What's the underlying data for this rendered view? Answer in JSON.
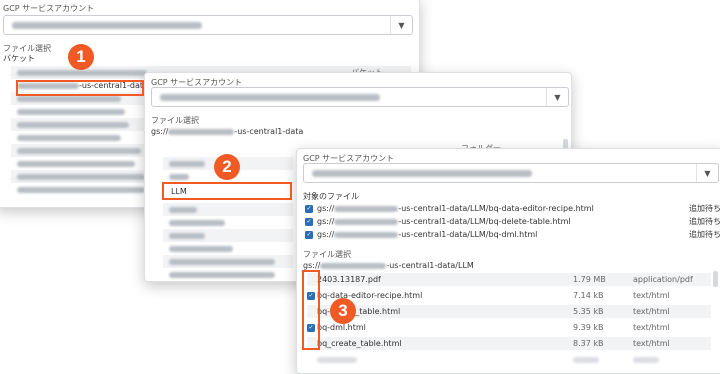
{
  "panel1": {
    "account_label": "GCP サービスアカウント",
    "file_select_label": "ファイル選択",
    "bucket_label": "バケット",
    "bucket_type": "バケット",
    "highlighted_suffix": "-us-central1-data"
  },
  "panel2": {
    "account_label": "GCP サービスアカウント",
    "file_select_label": "ファイル選択",
    "path_prefix": "gs://",
    "path_suffix": "-us-central1-data",
    "folder_type": "フォルダー",
    "folders": [
      "LLM"
    ]
  },
  "panel3": {
    "account_label": "GCP サービスアカウント",
    "target_files_label": "対象のファイル",
    "target_files": [
      {
        "prefix": "gs://",
        "suffix": "-us-central1-data/LLM/bq-data-editor-recipe.html",
        "status": "追加待ち"
      },
      {
        "prefix": "gs://",
        "suffix": "-us-central1-data/LLM/bq-delete-table.html",
        "status": "追加待ち"
      },
      {
        "prefix": "gs://",
        "suffix": "-us-central1-data/LLM/bq-dml.html",
        "status": "追加待ち"
      }
    ],
    "file_select_label": "ファイル選択",
    "path_prefix": "gs://",
    "path_suffix": "-us-central1-data/LLM",
    "files": [
      {
        "name": "2403.13187.pdf",
        "size": "1.79 MB",
        "type": "application/pdf"
      },
      {
        "name": "bq-data-editor-recipe.html",
        "size": "7.14 kB",
        "type": "text/html"
      },
      {
        "name": "bq-delete_table.html",
        "size": "5.35 kB",
        "type": "text/html"
      },
      {
        "name": "bq-dml.html",
        "size": "9.39 kB",
        "type": "text/html"
      },
      {
        "name": "bq_create_table.html",
        "size": "8.37 kB",
        "type": "text/html"
      }
    ]
  },
  "badges": {
    "one": "1",
    "two": "2",
    "three": "3"
  },
  "icons": {
    "dropdown": "chevron-down-icon",
    "checkbox": "check-icon"
  },
  "colors": {
    "accent": "#f15a24",
    "checkbox": "#2d6db5"
  }
}
